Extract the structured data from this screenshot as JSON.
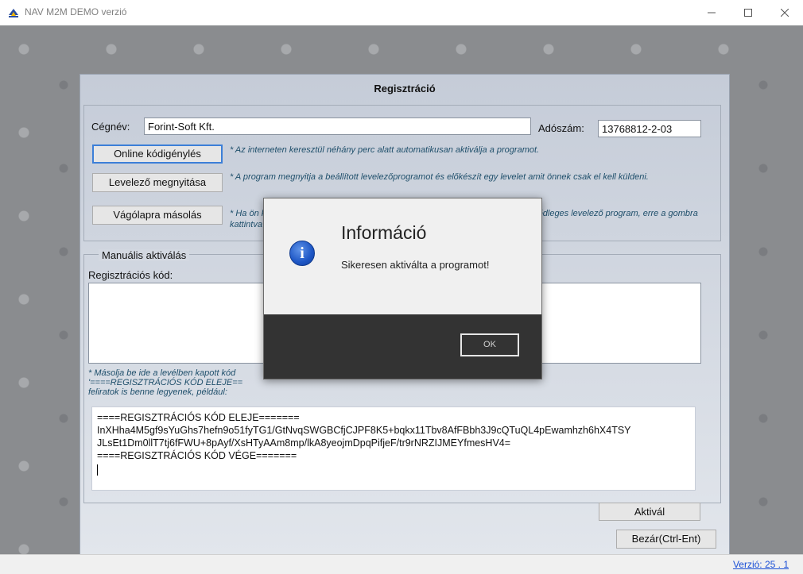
{
  "window": {
    "title": "NAV M2M DEMO verzió"
  },
  "status": {
    "version": "Verzió: 25 . 1"
  },
  "panel": {
    "title": "Regisztráció",
    "company_label": "Cégnév:",
    "company_value": "Forint-Soft Kft.",
    "tax_label": "Adószám:",
    "tax_value": "13768812-2-03",
    "btn_online": "Online kódigénylés",
    "hint_online": "* Az interneten keresztül néhány perc alatt automatikusan aktiválja a programot.",
    "btn_mail": "Levelező megnyitása",
    "hint_mail": "* A program megnyitja a beállított levelezőprogramot és előkészít egy levelet amit önnek csak el kell küldeni.",
    "btn_clip": "Vágólapra másolás",
    "hint_clip": "* Ha ön kézzel szeretné elküldeni a regisztrációs levelet vagy nincs beállítva elsődleges levelező program, erre a gombra kattintva a levél szükséges tartalma a vágólapra kerül."
  },
  "manual": {
    "legend": "Manuális aktiválás",
    "reg_label": "Regisztrációs kód:",
    "hint_line1": "* Másolja be ide a levélben kapott kód",
    "hint_line2": "'====REGISZTRÁCIÓS KÓD ELEJE==",
    "hint_line3": "feliratok is benne legyenek, például:",
    "code": [
      "====REGISZTRÁCIÓS KÓD ELEJE=======",
      "InXHha4M5gf9sYuGhs7hefn9o51fyTG1/GtNvqSWGBCfjCJPF8K5+bqkx11Tbv8AfFBbh3J9cQTuQL4pEwamhzh6hX4TSY",
      "JLsEt1Dm0llT7tj6fFWU+8pAyf/XsHTyAAm8mp/lkA8yeojmDpqPifjeF/tr9rNRZIJMEYfmesHV4=",
      "====REGISZTRÁCIÓS KÓD VÉGE======="
    ],
    "btn_activate": "Aktivál",
    "btn_close": "Bezár(Ctrl-Ent)"
  },
  "dialog": {
    "title": "Információ",
    "message": "Sikeresen aktiválta a programot!",
    "ok": "OK"
  }
}
